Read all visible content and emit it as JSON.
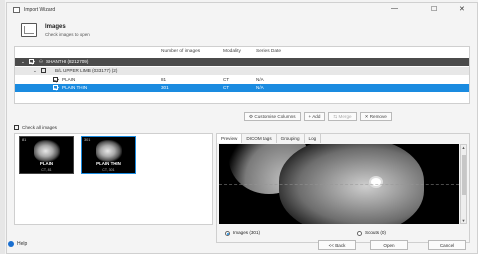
{
  "window": {
    "title": "Import Wizard",
    "minimize_glyph": "—",
    "maximize_glyph": "☐",
    "close_glyph": "✕"
  },
  "header": {
    "title": "Images",
    "subtitle": "Check images to open"
  },
  "tree": {
    "columns": [
      "Number of images",
      "Modality",
      "Series Date"
    ],
    "patient": {
      "label": "SHANTHI (8212709)"
    },
    "study": {
      "label": "B/L UPPER LIMB (033177) (2)"
    },
    "series": [
      {
        "label": "PLAIN",
        "images": "81",
        "modality": "CT",
        "date": "N/A",
        "checked": true,
        "selected": false
      },
      {
        "label": "PLAIN THIN",
        "images": "301",
        "modality": "CT",
        "date": "N/A",
        "checked": true,
        "selected": true
      }
    ]
  },
  "toolbar": {
    "customise": "Customise Columns",
    "add": "+ Add",
    "merge": "Merge",
    "remove": "Remove"
  },
  "check_all": "Check all images",
  "thumbnails": [
    {
      "count": "81",
      "label": "PLAIN",
      "sub": "CT, 81"
    },
    {
      "count": "301",
      "label": "PLAIN THIN",
      "sub": "CT, 301"
    }
  ],
  "preview": {
    "tabs": [
      "Preview",
      "DICOM tags",
      "Grouping",
      "Log"
    ],
    "active_tab": "Preview",
    "radio_images": "Images (301)",
    "radio_scouts": "Scouts (0)"
  },
  "footer": {
    "help": "Help",
    "back": "<< Back",
    "open": "Open",
    "cancel": "Cancel"
  }
}
